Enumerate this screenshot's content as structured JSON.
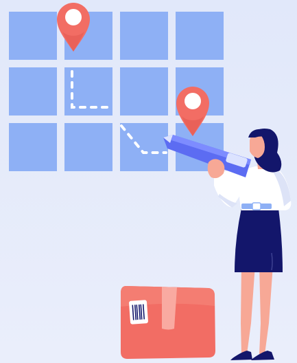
{
  "illustration": {
    "subject": "delivery-route-tracking",
    "grid": {
      "rows": 3,
      "cols": 4
    },
    "pins": 2,
    "elements": [
      "map-grid",
      "location-pin",
      "dashed-route",
      "pen",
      "woman",
      "parcel-box",
      "barcode-label"
    ]
  },
  "colors": {
    "background": "#e3e9f9",
    "tile": "#8eb0f5",
    "pin": "#f26d64",
    "pin_center": "#ffffff",
    "route": "#ffffff",
    "pen": "#5c6cf2",
    "pen_tip": "#dce3ff",
    "hair": "#13166b",
    "skirt": "#13166b",
    "shirt": "#ffffff",
    "skin": "#f7a896",
    "shoes": "#13166b",
    "box": "#f26d64",
    "box_tape": "#f9aaa1",
    "label": "#ffffff"
  }
}
